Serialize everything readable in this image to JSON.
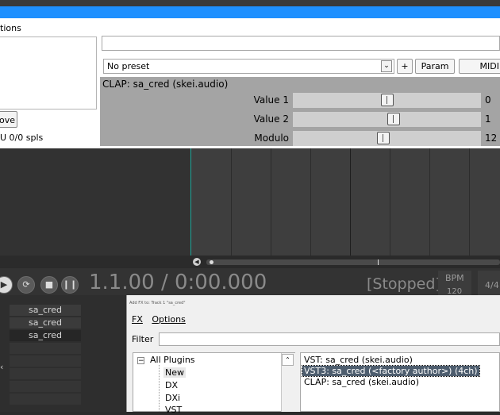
{
  "fx_window": {
    "menu_fragment": "tions",
    "remove_button": "ove",
    "cpu_text": "U 0/0 spls",
    "preset_select": "No preset",
    "plus_button": "+",
    "param_button": "Param",
    "midi_button": "MIDI",
    "plugin_title": "CLAP: sa_cred (skei.audio)",
    "params": [
      {
        "label": "Value 1",
        "value": "0",
        "level": 0.5
      },
      {
        "label": "Value 2",
        "value": "1",
        "level": 0.54
      },
      {
        "label": "Modulo",
        "value": "12",
        "level": 0.48
      }
    ]
  },
  "transport": {
    "time": "1.1.00 / 0:00.000",
    "status": "[Stopped]",
    "bpm_label": "BPM",
    "bpm_value": "120",
    "time_signature": "4/4"
  },
  "track_slots": [
    "sa_cred",
    "sa_cred",
    "sa_cred"
  ],
  "add_fx_dialog": {
    "title": "Add FX to: Track 1 \"sa_cred\"",
    "menu": [
      "FX",
      "Options"
    ],
    "filter_label": "Filter",
    "tree": [
      "All Plugins",
      "New",
      "DX",
      "DXi",
      "VST"
    ],
    "plugins": [
      "VST: sa_cred (skei.audio)",
      "VST3: sa_cred (<factory author>) (4ch)",
      "CLAP: sa_cred (skei.audio)"
    ],
    "selected_index": 1
  },
  "colors": {
    "accent_blue": "#1e90ff",
    "cursor": "#1fa89a",
    "selection": "#4d5d6e"
  }
}
